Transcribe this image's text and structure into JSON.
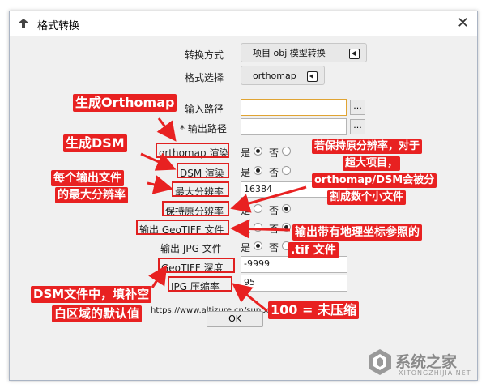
{
  "window": {
    "title": "格式转换",
    "close": "✕"
  },
  "form": {
    "convert_mode": {
      "label": "转换方式",
      "value": "项目 obj 模型转换"
    },
    "format": {
      "label": "格式选择",
      "value": "orthomap"
    },
    "input_path": {
      "label": "输入路径",
      "value": "",
      "browse": "..."
    },
    "output_path": {
      "label": "* 输出路径",
      "value": "",
      "browse": "..."
    },
    "ortho_render": {
      "label": "orthomap 渲染",
      "yes": "是",
      "no": "否",
      "selected": "是"
    },
    "dsm_render": {
      "label": "DSM 渲染",
      "yes": "是",
      "no": "否",
      "selected": "是"
    },
    "max_res": {
      "label": "最大分辨率",
      "value": "16384"
    },
    "keep_res": {
      "label": "保持原分辨率",
      "yes": "是",
      "no": "否",
      "selected": "否"
    },
    "geotiff": {
      "label": "输出 GeoTIFF 文件",
      "yes": "是",
      "no": "否",
      "selected": "否"
    },
    "jpg": {
      "label": "输出 JPG 文件",
      "yes": "是",
      "no": "否",
      "selected": "是"
    },
    "geotiff_depth": {
      "label": "GeoTIFF 深度",
      "value": "-9999"
    },
    "jpg_quality": {
      "label": "JPG 压缩率",
      "value": "95"
    },
    "url": "https://www.altizure.cn/support/artic",
    "ok": "OK"
  },
  "annotations": {
    "gen_ortho": "生成Orthomap",
    "gen_dsm": "生成DSM",
    "max_res_line1": "每个输出文件",
    "max_res_line2": "的最大分辨率",
    "keep_line1": "若保持原分辨率，对于",
    "keep_line2": "超大项目，",
    "keep_line3": "orthomap/DSM会被分",
    "keep_line4": "割成数个小文件",
    "geo_line1": "输出带有地理坐标参照的",
    "geo_line2": ".tif 文件",
    "dsm_fill_line1": "DSM文件中，填补空",
    "dsm_fill_line2": "白区域的默认值",
    "quality_note": "100 = 未压缩"
  },
  "watermark": {
    "cn": "系统之家",
    "en": "XITONGZHIJIA.NET"
  },
  "colors": {
    "annotation_red": "#e82121",
    "focus_border": "#e0a433"
  }
}
